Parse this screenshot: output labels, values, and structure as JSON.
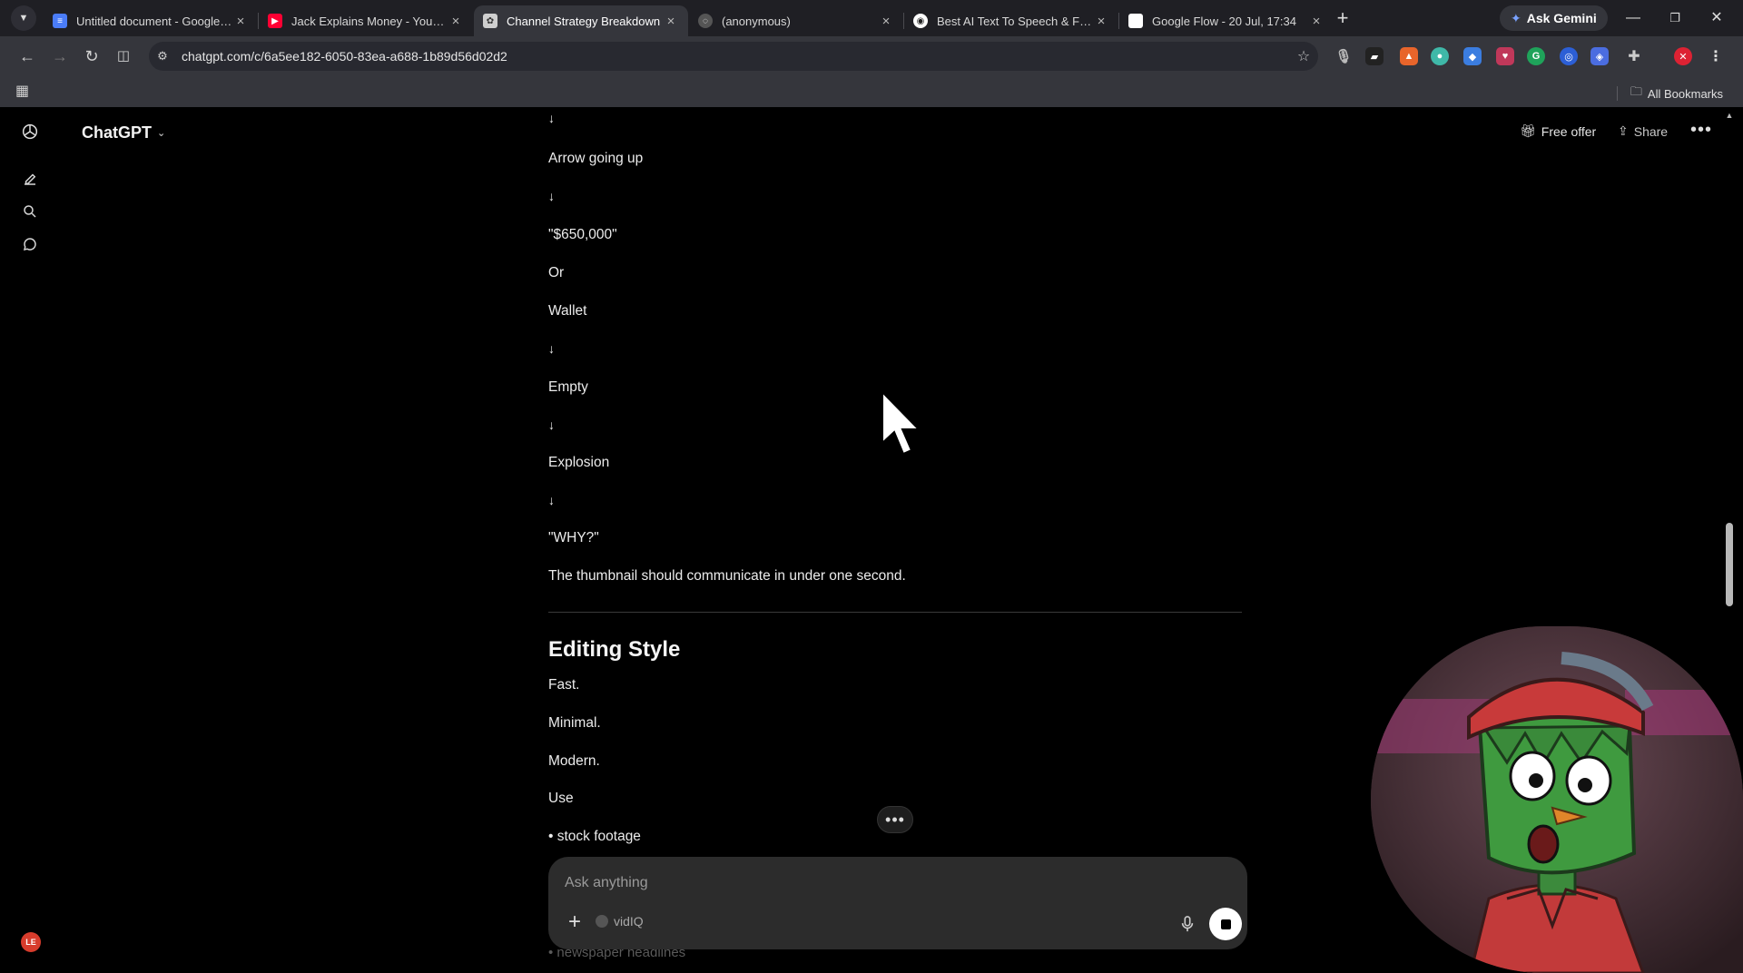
{
  "browser": {
    "tabs": [
      {
        "title": "Untitled document - Google Docs",
        "icon": "google-docs-icon",
        "color": "#4a7cf7"
      },
      {
        "title": "Jack Explains Money - YouTube",
        "icon": "youtube-icon",
        "color": "#ff0033"
      },
      {
        "title": "Channel Strategy Breakdown",
        "icon": "chatgpt-icon",
        "color": "#cfcfcf"
      },
      {
        "title": "(anonymous)",
        "icon": "globe-icon",
        "color": "#777777"
      },
      {
        "title": "Best AI Text To Speech & Free Voice",
        "icon": "tts-icon",
        "color": "#ffffff"
      },
      {
        "title": "Google Flow - 20 Jul, 17:34",
        "icon": "page-icon",
        "color": "#ffffff"
      }
    ],
    "new_tab": "+",
    "ask_gemini": "Ask Gemini",
    "url": "chatgpt.com/c/6a5ee182-6050-83ea-a688-1b89d56d02d2",
    "all_bookmarks": "All Bookmarks"
  },
  "app": {
    "title": "ChatGPT",
    "free_offer": "Free offer",
    "share": "Share",
    "avatar_initials": "LE"
  },
  "thread": {
    "lines": [
      {
        "kind": "arrow",
        "text": "↓"
      },
      {
        "kind": "text",
        "text": "Arrow going up"
      },
      {
        "kind": "arrow",
        "text": "↓"
      },
      {
        "kind": "text",
        "text": "\"$650,000\""
      },
      {
        "kind": "text",
        "text": "Or"
      },
      {
        "kind": "text",
        "text": "Wallet"
      },
      {
        "kind": "arrow",
        "text": "↓"
      },
      {
        "kind": "text",
        "text": "Empty"
      },
      {
        "kind": "arrow",
        "text": "↓"
      },
      {
        "kind": "text",
        "text": "Explosion"
      },
      {
        "kind": "arrow",
        "text": "↓"
      },
      {
        "kind": "text",
        "text": "\"WHY?\""
      },
      {
        "kind": "text",
        "text": "The thumbnail should communicate in under one second."
      }
    ],
    "section_heading": "Editing Style",
    "section_lines": [
      "Fast.",
      "Minimal.",
      "Modern.",
      "Use",
      "• stock footage"
    ],
    "faded_line": "• newspaper headlines"
  },
  "composer": {
    "placeholder": "Ask anything",
    "tool_label": "vidIQ"
  }
}
